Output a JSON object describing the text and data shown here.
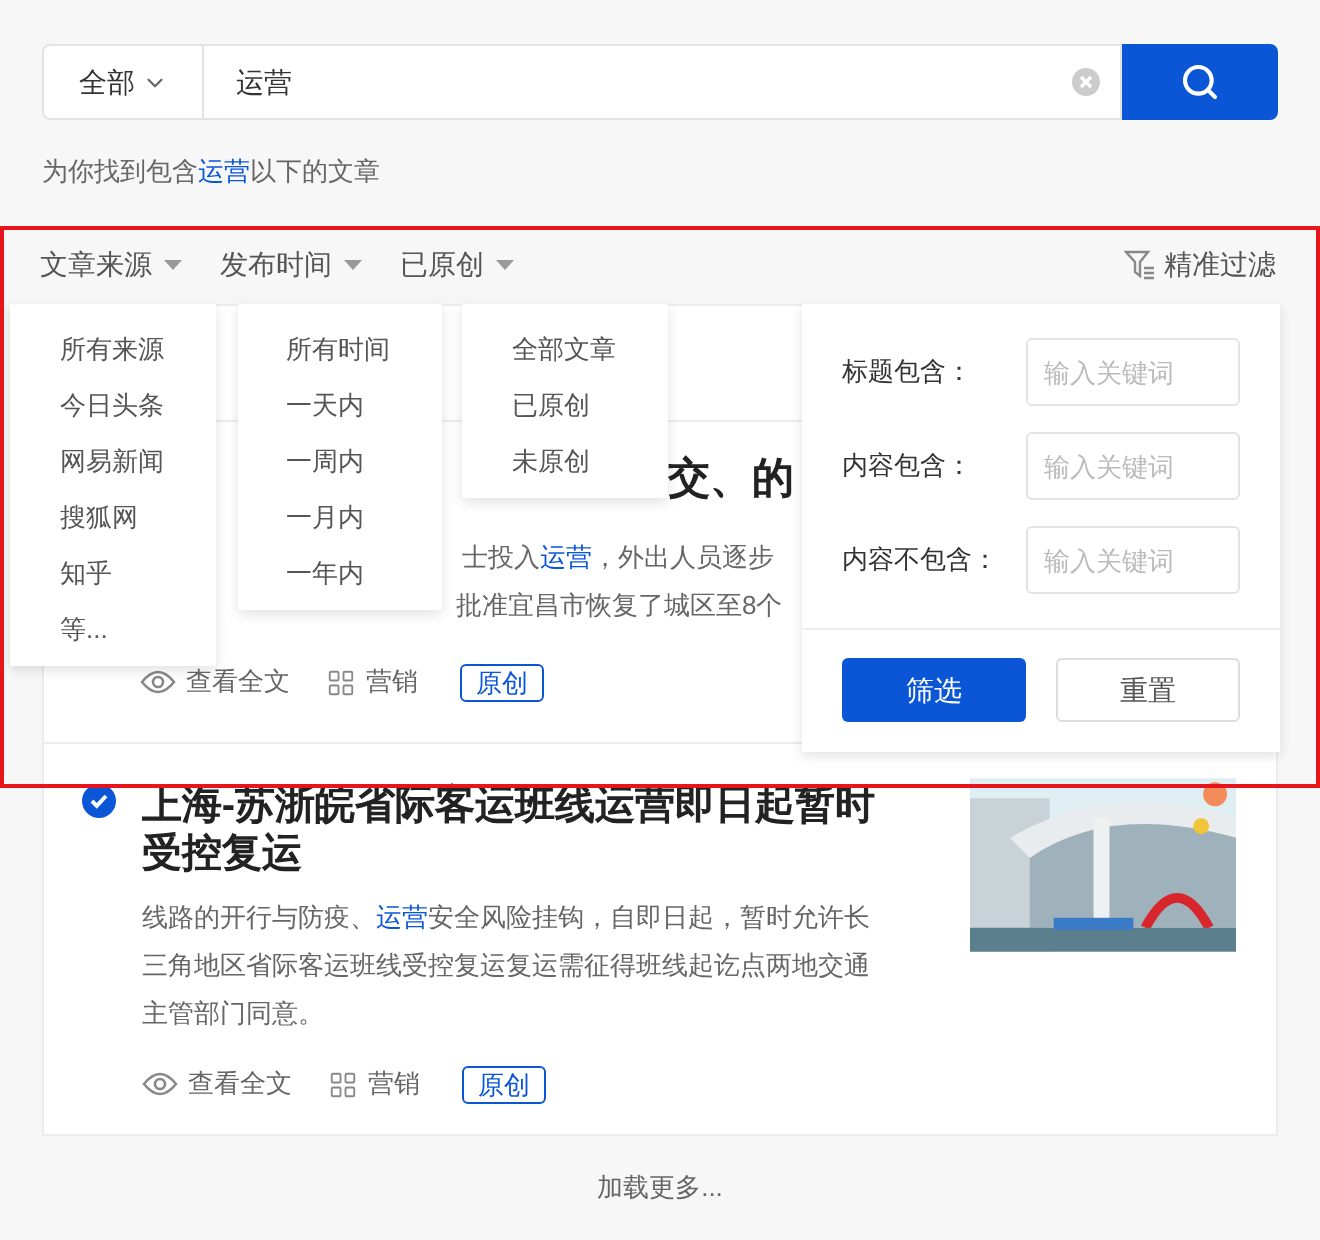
{
  "search": {
    "scope": "全部",
    "value": "运营"
  },
  "result_note": {
    "before": "为你找到包含",
    "keyword": "运营",
    "after": "以下的文章"
  },
  "filters": [
    {
      "label": "文章来源",
      "options": [
        "所有来源",
        "今日头条",
        "网易新闻",
        "搜狐网",
        "知乎",
        "等..."
      ]
    },
    {
      "label": "发布时间",
      "options": [
        "所有时间",
        "一天内",
        "一周内",
        "一月内",
        "一年内"
      ]
    },
    {
      "label": "已原创",
      "options": [
        "全部文章",
        "已原创",
        "未原创"
      ]
    }
  ],
  "precise_filter": {
    "label": "精准过滤",
    "fields": [
      {
        "label": "标题包含：",
        "placeholder": "输入关键词"
      },
      {
        "label": "内容包含：",
        "placeholder": "输入关键词"
      },
      {
        "label": "内容不包含：",
        "placeholder": "输入关键词"
      }
    ],
    "buttons": [
      {
        "label": "筛选",
        "kind": "primary"
      },
      {
        "label": "重置",
        "kind": "secondary"
      }
    ]
  },
  "articles": [
    {
      "kind": "covered",
      "title_fragment": "交、的",
      "body_lines": [
        [
          {
            "text": "士投入"
          },
          {
            "text": "运营",
            "highlight": true
          },
          {
            "text": "，外出人员逐步"
          }
        ],
        [
          {
            "text": "批准宜昌市恢复了城区至8个"
          }
        ]
      ],
      "actions": {
        "view": "查看全文",
        "marketing": "营销",
        "tag": "原创"
      }
    },
    {
      "kind": "full",
      "checked": true,
      "title": "上海-苏浙皖省际客运班线运营即日起暂时受控复运",
      "body": [
        {
          "text": "线路的开行与防疫、"
        },
        {
          "text": "运营",
          "highlight": true
        },
        {
          "text": "安全风险挂钩，自即日起，暂时允许长三角地区省际客运班线受控复运复运需征得班线起讫点两地交通主管部门同意。"
        }
      ],
      "actions": {
        "view": "查看全文",
        "marketing": "营销",
        "tag": "原创"
      }
    }
  ],
  "load_more": "加载更多..."
}
